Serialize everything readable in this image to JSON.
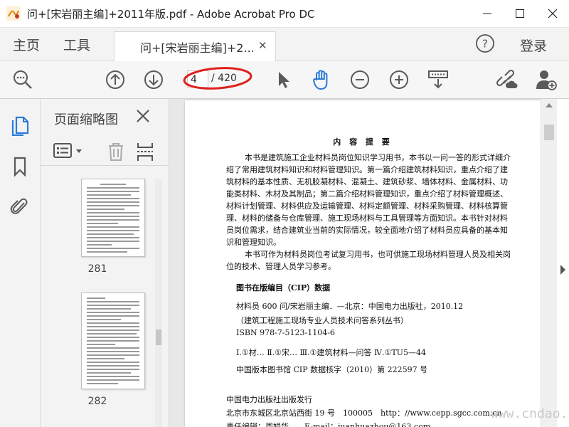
{
  "window": {
    "title": "问+[宋岩丽主编]+2011年版.pdf - Adobe Acrobat Pro DC"
  },
  "menu": {
    "home": "主页",
    "tools": "工具",
    "doc_tab": "问+[宋岩丽主编]+2...",
    "login": "登录"
  },
  "toolbar": {
    "current_page": "4",
    "total_pages": "/ 420"
  },
  "panel": {
    "title": "页面缩略图",
    "thumbnails": [
      {
        "page": "281"
      },
      {
        "page": "282"
      }
    ]
  },
  "document": {
    "heading": "内 容 提 要",
    "lines": [
      "　　本书是建筑施工企业材料员岗位知识学习用书，本书以一问一答的形式详细介",
      "绍了常用建筑材料知识和材料管理知识。第一篇介绍建筑材料知识，重点介绍了建",
      "筑材料的基本性质、无机胶凝材料、混凝土、建筑砂浆、墙体材料、金属材料、功",
      "能类材料、木材及其制品；第二篇介绍材料管理知识，重点介绍了材料管理概述、",
      "材料计划管理、材料供应及运输管理、材料定额管理、材料采购管理、材料核算管",
      "理、材料的储备与仓库管理、施工现场材料与工具管理等方面知识。本书针对材料",
      "员岗位需求，结合建筑业当前的实际情况，较全面地介绍了材料员应具备的基本知",
      "识和管理知识。",
      "　　本书可作为材料员岗位考试复习用书，也可供施工现场材料管理人员及相关岗",
      "位的技术、管理人员学习参考。"
    ],
    "cip_title": "图书在版编目（CIP）数据",
    "cip_lines": [
      "材料员 600 问/宋岩丽主编．—北京：中国电力出版社，2010.12",
      "（建筑工程施工现场专业人员技术问答系列丛书）",
      "ISBN 978-7-5123-1104-6",
      "Ⅰ.①材…  Ⅱ.①宋…  Ⅲ.①建筑材料—问答  Ⅳ.①TU5—44",
      "中国版本图书馆 CIP 数据核字（2010）第 222597 号"
    ],
    "publisher_lines": [
      "中国电力出版社出版发行",
      "北京市东城区北京站西街 19 号　100005　http：//www.cepp.sgcc.com.cn",
      "责任编辑：周娟华　　E-mail：juanhuazhou@163.com"
    ]
  },
  "watermark": "www.cndao.com",
  "colors": {
    "accent_red": "#e0201b",
    "toolbar_bg": "#f6f6f6",
    "icon_gray": "#5a5a5a",
    "icon_blue": "#2a7bd6"
  }
}
